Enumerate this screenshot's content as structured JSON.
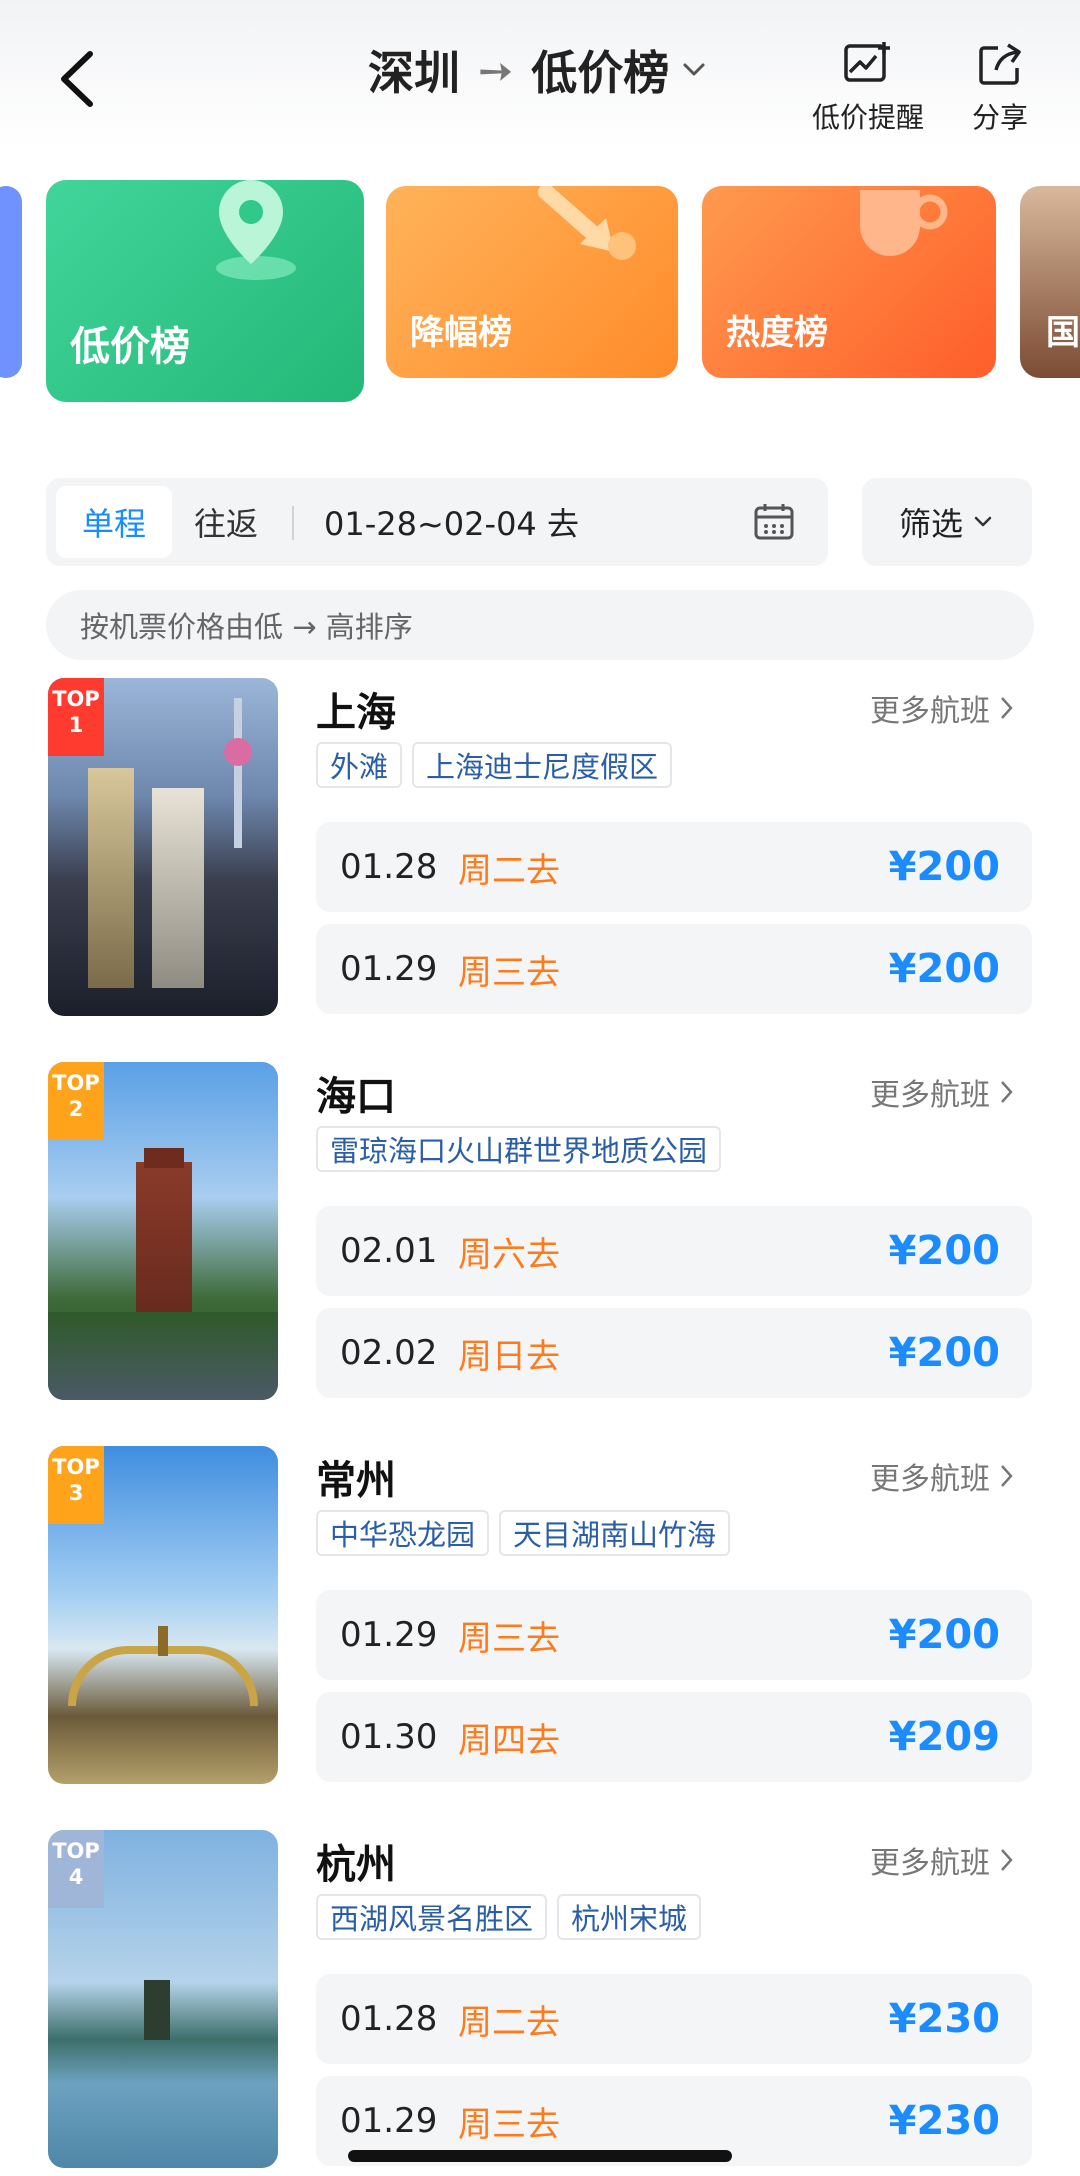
{
  "header": {
    "from": "深圳",
    "arrow": "➙",
    "title": "低价榜",
    "alert_label": "低价提醒",
    "share_label": "分享"
  },
  "categories": [
    {
      "name": "低价榜"
    },
    {
      "name": "降幅榜"
    },
    {
      "name": "热度榜"
    },
    {
      "name": "国"
    }
  ],
  "filter": {
    "oneway_label": "单程",
    "roundtrip_label": "往返",
    "date_range": "01-28~02-04 去",
    "filter_label": "筛选",
    "sort_text": "按机票价格由低 → 高排序"
  },
  "more_label": "更多航班",
  "destinations": [
    {
      "rank_top": "TOP",
      "rank_num": "1",
      "city": "上海",
      "tags": [
        "外滩",
        "上海迪士尼度假区"
      ],
      "flights": [
        {
          "date": "01.28",
          "day": "周二去",
          "price": "¥200"
        },
        {
          "date": "01.29",
          "day": "周三去",
          "price": "¥200"
        }
      ]
    },
    {
      "rank_top": "TOP",
      "rank_num": "2",
      "city": "海口",
      "tags": [
        "雷琼海口火山群世界地质公园"
      ],
      "flights": [
        {
          "date": "02.01",
          "day": "周六去",
          "price": "¥200"
        },
        {
          "date": "02.02",
          "day": "周日去",
          "price": "¥200"
        }
      ]
    },
    {
      "rank_top": "TOP",
      "rank_num": "3",
      "city": "常州",
      "tags": [
        "中华恐龙园",
        "天目湖南山竹海"
      ],
      "flights": [
        {
          "date": "01.29",
          "day": "周三去",
          "price": "¥200"
        },
        {
          "date": "01.30",
          "day": "周四去",
          "price": "¥209"
        }
      ]
    },
    {
      "rank_top": "TOP",
      "rank_num": "4",
      "city": "杭州",
      "tags": [
        "西湖风景名胜区",
        "杭州宋城"
      ],
      "flights": [
        {
          "date": "01.28",
          "day": "周二去",
          "price": "¥230"
        },
        {
          "date": "01.29",
          "day": "周三去",
          "price": "¥230"
        }
      ]
    }
  ],
  "colors": {
    "accent_blue": "#1a8cff",
    "weekday_orange": "#ff7a1a",
    "rank1_red": "#ff3b30",
    "rank_orange": "#ffa31a"
  }
}
